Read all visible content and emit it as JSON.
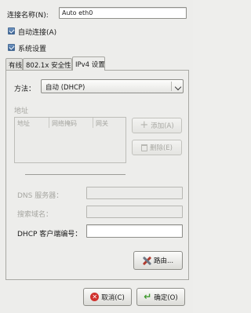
{
  "connection_name": {
    "label": "连接名称(N):",
    "value": "Auto eth0"
  },
  "auto_connect": {
    "label": "自动连接(A)",
    "checked": true
  },
  "system_setting": {
    "label": "系统设置",
    "checked": true
  },
  "tabs": [
    {
      "label": "有线",
      "active": false
    },
    {
      "label": "802.1x 安全性",
      "active": false
    },
    {
      "label": "IPv4 设置",
      "active": true
    }
  ],
  "ipv4": {
    "method_label": "方法：",
    "method_value": "自动 (DHCP)",
    "address_section": "地址",
    "columns": [
      "地址",
      "网络掩码",
      "网关"
    ],
    "add_button": "添加(A)",
    "delete_button": "删除(E)",
    "dns_label": "DNS 服务器：",
    "dns_value": "",
    "search_domains_label": "搜索域名：",
    "search_domains_value": "",
    "dhcp_client_id_label": "DHCP 客户端编号：",
    "dhcp_client_id_value": "",
    "routes_button": "路由..."
  },
  "footer": {
    "cancel_button": "取消(C)",
    "ok_button": "确定(O)"
  },
  "colors": {
    "cancel_icon": "#d0312d",
    "ok_icon": "#3f9a2e",
    "check_fill": "#4f79aa"
  }
}
